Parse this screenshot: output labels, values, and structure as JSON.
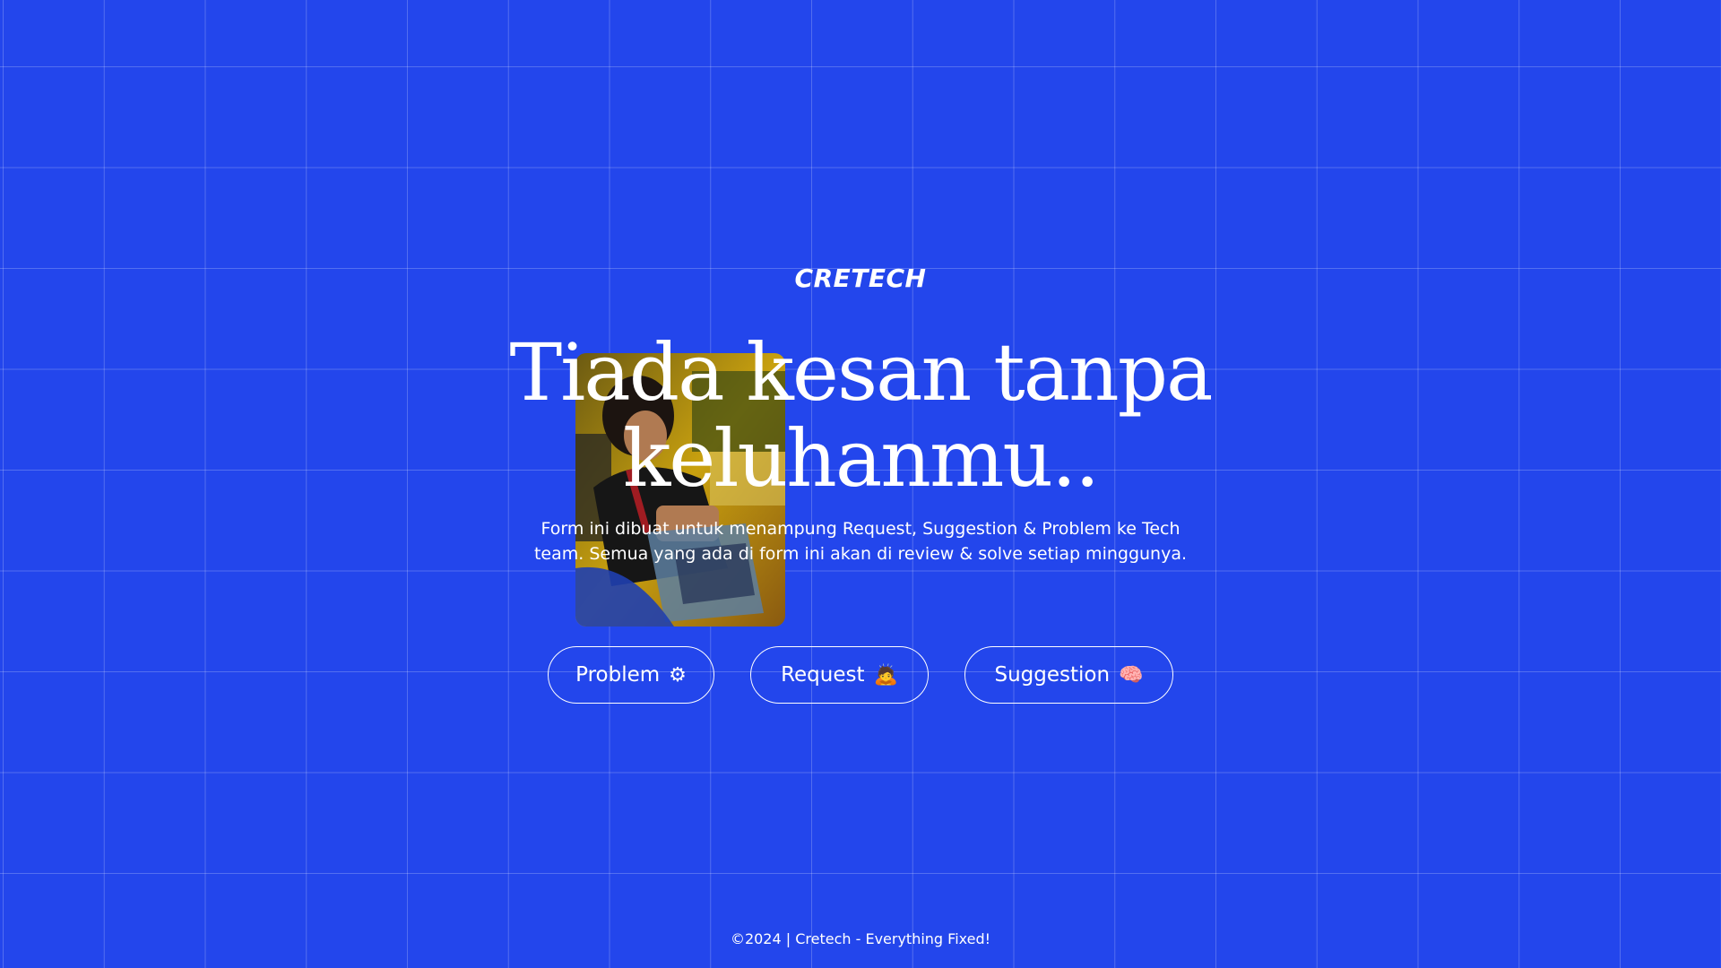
{
  "brand": {
    "name": "CRETECH"
  },
  "hero": {
    "headline_line1": "Tiada kesan tanpa",
    "headline_line2": "keluhanmu..",
    "description_line1": "Form ini dibuat untuk menampung Request, Suggestion & Problem ke Tech",
    "description_line2": "team. Semua yang ada di form ini akan di review & solve setiap minggunya."
  },
  "actions": [
    {
      "label": "Problem",
      "emoji": "⚙"
    },
    {
      "label": "Request",
      "emoji": "🙇"
    },
    {
      "label": "Suggestion",
      "emoji": "🧠"
    }
  ],
  "footer": {
    "text": "©2024 | Cretech - Everything Fixed!"
  },
  "colors": {
    "background": "#2346ec",
    "text": "#ffffff",
    "grid": "rgba(255,255,255,0.22)"
  }
}
